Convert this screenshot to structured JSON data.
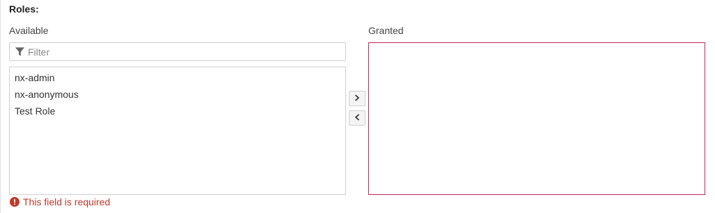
{
  "section": {
    "title": "Roles:"
  },
  "available": {
    "label": "Available",
    "filter_placeholder": "Filter",
    "filter_value": "",
    "items": [
      "nx-admin",
      "nx-anonymous",
      "Test Role"
    ]
  },
  "granted": {
    "label": "Granted",
    "items": []
  },
  "buttons": {
    "add_icon": "chevron-right-icon",
    "remove_icon": "chevron-left-icon"
  },
  "validation": {
    "message": "This field is required",
    "icon": "exclamation-circle-icon",
    "color": "#c0392b"
  },
  "colors": {
    "error_border": "#c0215b",
    "border": "#cfcfcf"
  }
}
